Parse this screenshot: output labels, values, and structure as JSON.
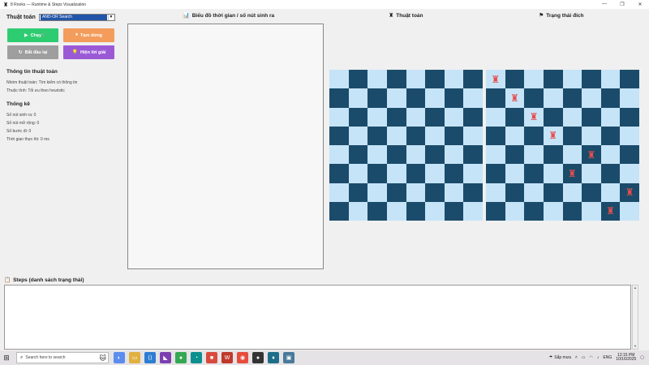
{
  "window": {
    "title": "8 Rooks — Runtime & Steps Visualization",
    "controls": [
      "—",
      "❐",
      "✕"
    ]
  },
  "controls": {
    "algorithm_label": "Thuật toán",
    "algorithm_selected": "AND-OR Search",
    "run_label": "Chạy",
    "pause_label": "Tạm dừng",
    "reset_label": "Bắt đầu lại",
    "solution_label": "Hiện lời giải"
  },
  "info": {
    "title": "Thông tin thuật toán",
    "group": "Nhóm thuật toán: Tìm kiếm có thông tin",
    "property": "Thuộc tính: Tối ưu theo heuristic"
  },
  "stats": {
    "title": "Thống kê",
    "generated": "Số nút sinh ra: 0",
    "expanded": "Số nút mở rộng: 0",
    "steps": "Số bước đi: 0",
    "runtime": "Thời gian thực thi: 0 ms"
  },
  "panels": {
    "chart_title": "Biểu đồ thời gian / số nút sinh ra",
    "algo_board_title": "Thuật toán",
    "goal_board_title": "Trạng thái đích"
  },
  "boards": {
    "algo_rooks": [],
    "goal_rooks": [
      [
        0,
        0
      ],
      [
        1,
        1
      ],
      [
        2,
        2
      ],
      [
        3,
        3
      ],
      [
        4,
        5
      ],
      [
        5,
        4
      ],
      [
        6,
        7
      ],
      [
        7,
        6
      ]
    ]
  },
  "steps": {
    "title": "Steps (danh sách trạng thái)"
  },
  "taskbar": {
    "search_placeholder": "Search here to search",
    "weather": "Sắp mưa",
    "lang": "ENG",
    "time": "12:15 PM",
    "date": "10/16/2025"
  },
  "colors": {
    "dark_square": "#1b4b6a",
    "light_square": "#c6e4f8",
    "rook": "#e84c4c",
    "run": "#2ecc71",
    "pause": "#f39c5b",
    "reset": "#9e9e9e",
    "solution": "#9b59d6"
  }
}
